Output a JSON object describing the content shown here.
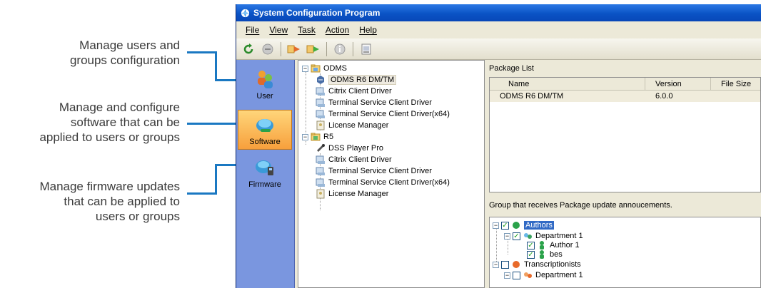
{
  "callouts": [
    {
      "text_line1": "Manage users and",
      "text_line2": "groups configuration"
    },
    {
      "text_line1": "Manage and configure",
      "text_line2": "software that can be",
      "text_line3": "applied to users or groups"
    },
    {
      "text_line1": "Manage firmware updates",
      "text_line2": "that can be applied to",
      "text_line3": "users or groups"
    }
  ],
  "window": {
    "title": "System Configuration Program",
    "menu": [
      "File",
      "View",
      "Task",
      "Action",
      "Help"
    ]
  },
  "toolbar": {
    "buttons": [
      "refresh-icon",
      "stop-icon",
      "import-icon",
      "export-icon",
      "info-icon",
      "settings-icon"
    ]
  },
  "sidebar": {
    "items": [
      {
        "label": "User",
        "active": false
      },
      {
        "label": "Software",
        "active": true
      },
      {
        "label": "Firmware",
        "active": false
      }
    ]
  },
  "tree": {
    "groups": [
      {
        "label": "ODMS",
        "children": [
          "ODMS R6 DM/TM",
          "Citrix Client Driver",
          "Terminal Service Client Driver",
          "Terminal Service Client Driver(x64)",
          "License Manager"
        ]
      },
      {
        "label": "R5",
        "children": [
          "DSS Player Pro",
          "Citrix Client Driver",
          "Terminal Service Client Driver",
          "Terminal Service Client Driver(x64)",
          "License Manager"
        ]
      }
    ],
    "selected": "ODMS R6 DM/TM"
  },
  "package_list": {
    "title": "Package List",
    "columns": [
      "Name",
      "Version",
      "File Size"
    ],
    "rows": [
      {
        "name": "ODMS R6 DM/TM",
        "version": "6.0.0",
        "size": ""
      }
    ]
  },
  "group_tree": {
    "title": "Group that receives Package update annoucements.",
    "items": [
      {
        "label": "Authors",
        "checked": true,
        "selected": true
      },
      {
        "label": "Department 1",
        "checked": true
      },
      {
        "label": "Author 1",
        "checked": true
      },
      {
        "label": "bes",
        "checked": true
      },
      {
        "label": "Transcriptionists",
        "checked": false
      },
      {
        "label": "Department 1",
        "checked": false
      }
    ]
  },
  "colors": {
    "accent": "#1a78c2",
    "titlebar": "#0a53c5",
    "sidebar": "#7a96df",
    "active_tab": "#f7a03c",
    "selection": "#316ac5"
  }
}
